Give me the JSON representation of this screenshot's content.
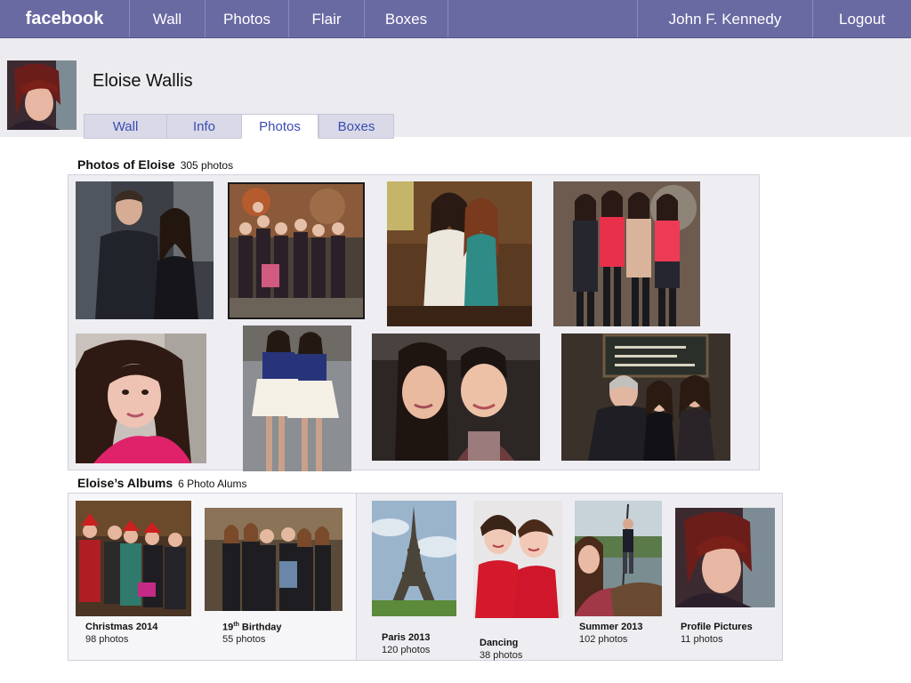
{
  "topnav": {
    "logo": "facebook",
    "items": [
      "Wall",
      "Photos",
      "Flair",
      "Boxes"
    ],
    "user": "John F. Kennedy",
    "logout": "Logout"
  },
  "profile": {
    "name": "Eloise Wallis",
    "tabs": [
      "Wall",
      "Info",
      "Photos",
      "Boxes"
    ],
    "active_tab": "Photos"
  },
  "photos_section": {
    "title": "Photos of Eloise",
    "count": "305 photos"
  },
  "albums_section": {
    "title": "Eloise’s Albums",
    "count": "6 Photo Alums"
  },
  "albums": [
    {
      "name": "Christmas 2014",
      "count": "98 photos"
    },
    {
      "name_prefix": "19",
      "name_sup": "th",
      "name_suffix": " Birthday",
      "count": "55 photos"
    },
    {
      "name": "Paris 2013",
      "count": "120 photos"
    },
    {
      "name": "Dancing",
      "count": "38 photos"
    },
    {
      "name": "Summer 2013",
      "count": "102 photos"
    },
    {
      "name": "Profile Pictures",
      "count": "11 photos"
    }
  ],
  "colors": {
    "topbar": "#6a6aa3",
    "tab_link": "#3b4bb0",
    "panel_bg": "#ededf2"
  }
}
